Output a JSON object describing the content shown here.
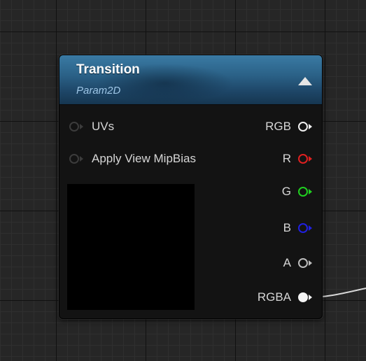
{
  "node": {
    "title": "Transition",
    "subtitle": "Param2D",
    "collapse_icon": "triangle-up-icon",
    "inputs": [
      {
        "label": "UVs",
        "pin_color": "#3c3c3c",
        "connected": false
      },
      {
        "label": "Apply View MipBias",
        "pin_color": "#3c3c3c",
        "connected": false
      }
    ],
    "outputs": [
      {
        "label": "RGB",
        "pin_color": "#f0f0f0",
        "connected": false
      },
      {
        "label": "R",
        "pin_color": "#e02020",
        "connected": false
      },
      {
        "label": "G",
        "pin_color": "#20d020",
        "connected": false
      },
      {
        "label": "B",
        "pin_color": "#2020e0",
        "connected": false
      },
      {
        "label": "A",
        "pin_color": "#bdbdbd",
        "connected": false
      },
      {
        "label": "RGBA",
        "pin_color": "#f4f4f4",
        "connected": true
      }
    ],
    "header_color": "#2b6288",
    "preview_color": "#000000"
  },
  "graph": {
    "background_color": "#262626",
    "wire_color": "#d8d8d8"
  }
}
